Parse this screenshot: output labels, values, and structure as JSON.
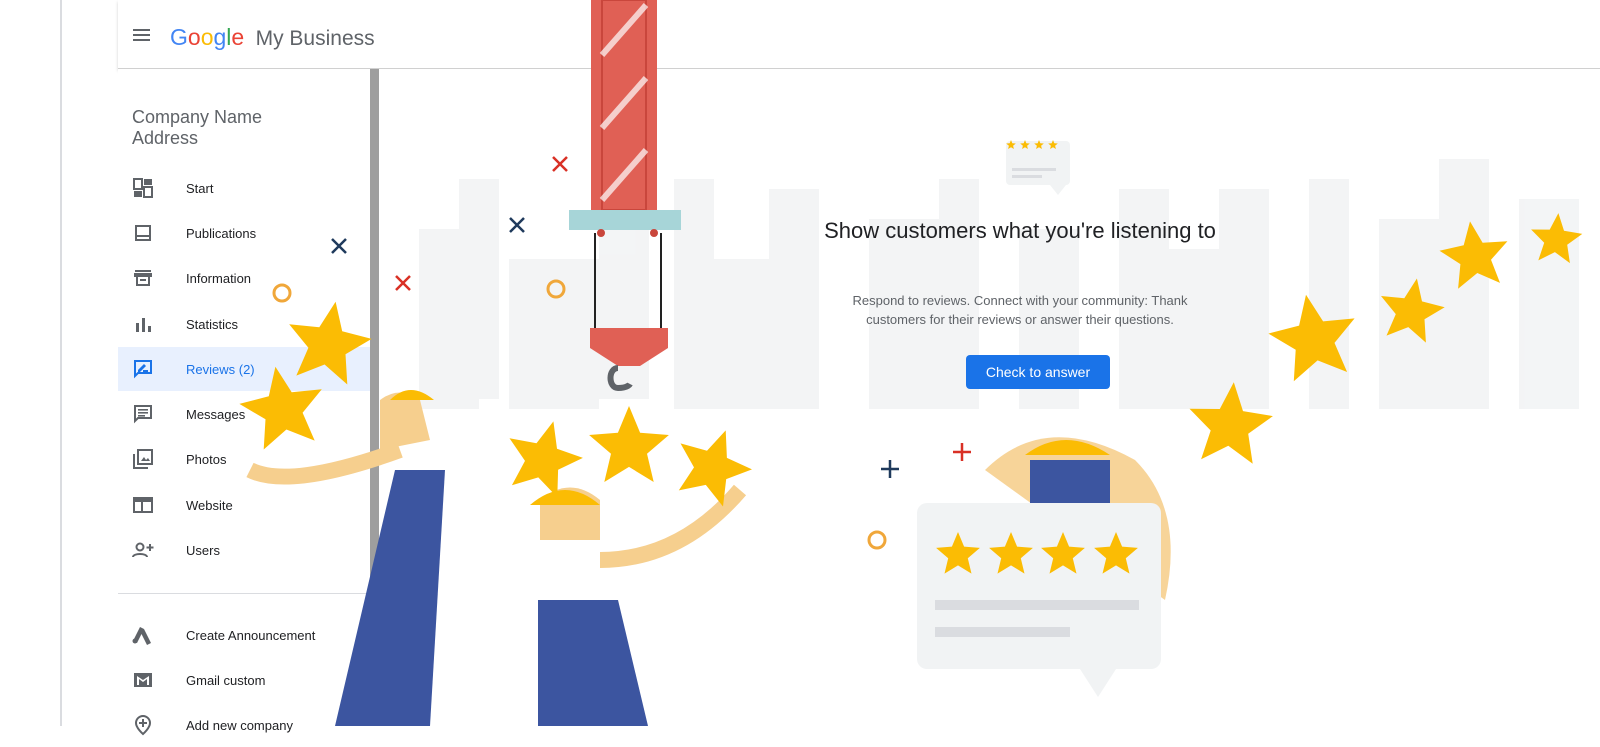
{
  "header": {
    "logo_letters": [
      "G",
      "o",
      "o",
      "g",
      "l",
      "e"
    ],
    "logo_colors": [
      "#4285F4",
      "#EA4335",
      "#FBBC05",
      "#4285F4",
      "#34A853",
      "#EA4335"
    ],
    "product_name": "My Business"
  },
  "sidebar": {
    "business_name": "Company Name",
    "business_address": "Address",
    "items": [
      {
        "label": "Start",
        "icon": "dashboard-icon",
        "active": false
      },
      {
        "label": "Publications",
        "icon": "posts-icon",
        "active": false
      },
      {
        "label": "Information",
        "icon": "storefront-icon",
        "active": false
      },
      {
        "label": "Statistics",
        "icon": "bar-chart-icon",
        "active": false
      },
      {
        "label": "Reviews (2)",
        "icon": "rate-review-icon",
        "active": true
      },
      {
        "label": "Messages",
        "icon": "chat-icon",
        "active": false
      },
      {
        "label": "Photos",
        "icon": "photo-library-icon",
        "active": false
      },
      {
        "label": "Website",
        "icon": "web-icon",
        "active": false
      },
      {
        "label": "Users",
        "icon": "person-add-icon",
        "active": false
      }
    ],
    "secondary_items": [
      {
        "label": "Create Announcement",
        "icon": "ads-icon"
      },
      {
        "label": "Gmail custom",
        "icon": "gmail-icon"
      },
      {
        "label": "Add new company",
        "icon": "add-location-icon"
      }
    ]
  },
  "main": {
    "headline": "Show customers what you're listening to",
    "description": "Respond to reviews. Connect with your community: Thank customers for their reviews or answer their questions.",
    "cta_label": "Check to answer"
  },
  "colors": {
    "accent": "#1a73e8",
    "active_bg": "#e8f0fe",
    "star": "#FBBC04",
    "crane": "#e06055"
  }
}
